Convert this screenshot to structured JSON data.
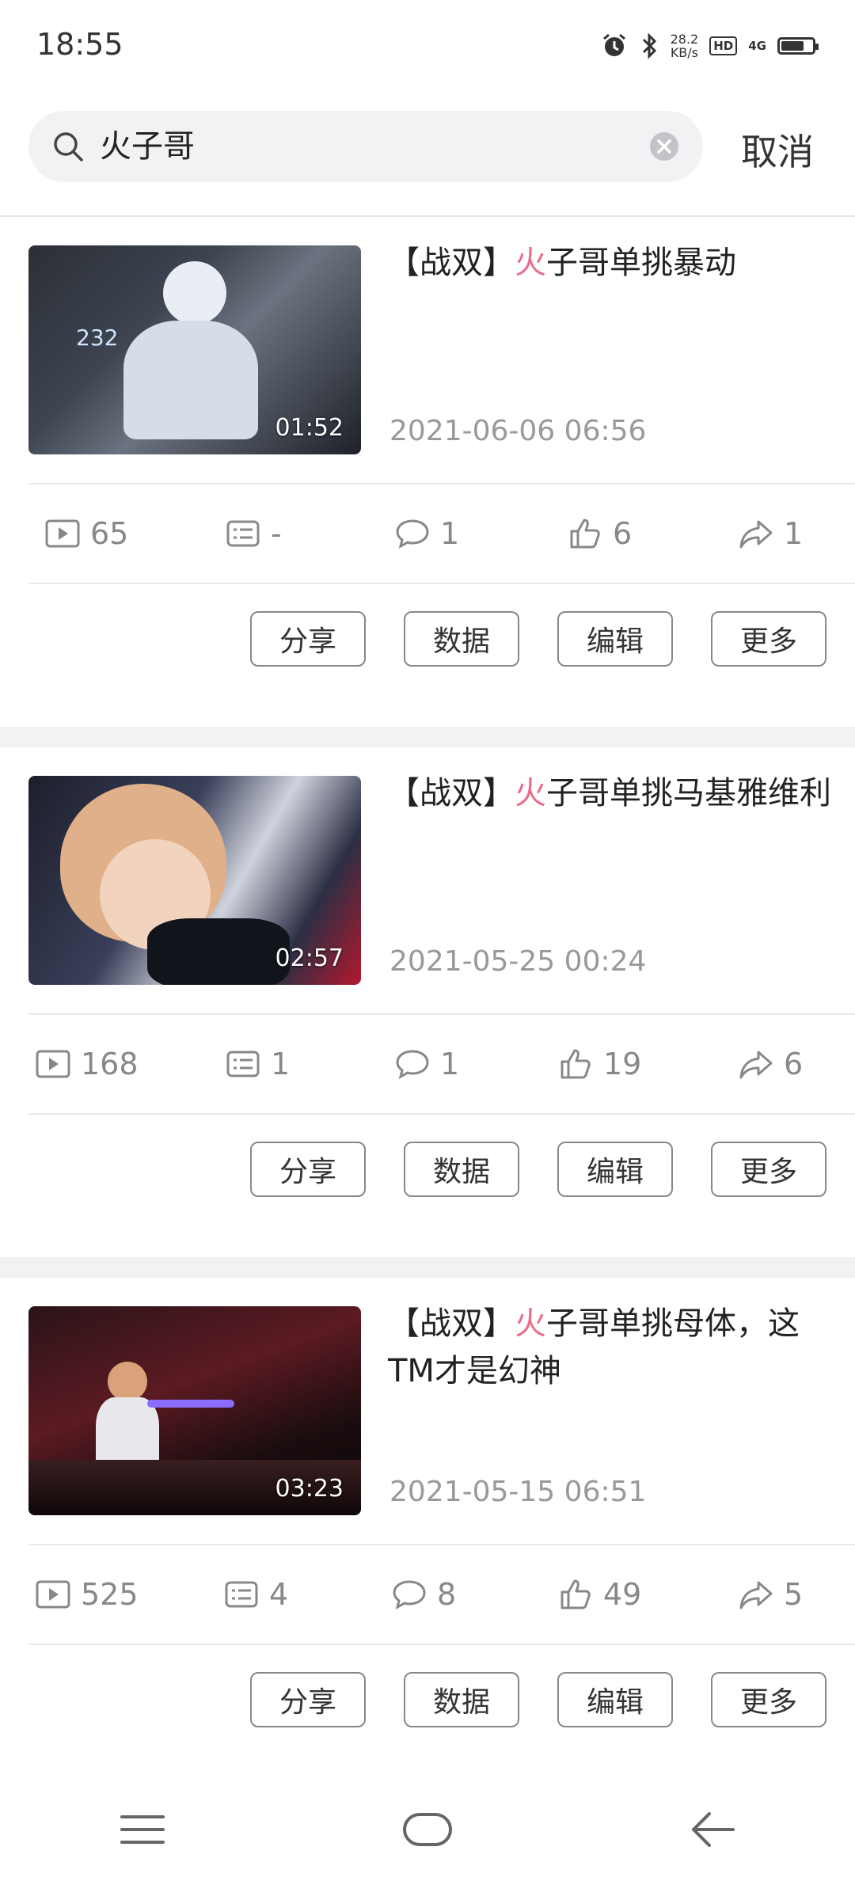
{
  "status_bar": {
    "time": "18:55",
    "net_speed": "28.2",
    "net_unit": "KB/s",
    "hd": "HD",
    "signal": "4G"
  },
  "search": {
    "query": "火子哥",
    "cancel_label": "取消"
  },
  "videos": [
    {
      "title_prefix": "【战双】",
      "title_highlight": "火",
      "title_rest": "子哥单挑暴动",
      "duration": "01:52",
      "date": "2021-06-06 06:56",
      "plays": "65",
      "danmaku": "-",
      "comments": "1",
      "likes": "6",
      "shares": "1"
    },
    {
      "title_prefix": "【战双】",
      "title_highlight": "火",
      "title_rest": "子哥单挑马基雅维利",
      "duration": "02:57",
      "date": "2021-05-25 00:24",
      "plays": "168",
      "danmaku": "1",
      "comments": "1",
      "likes": "19",
      "shares": "6"
    },
    {
      "title_prefix": "【战双】",
      "title_highlight": "火",
      "title_rest": "子哥单挑母体，这TM才是幻神",
      "duration": "03:23",
      "date": "2021-05-15 06:51",
      "plays": "525",
      "danmaku": "4",
      "comments": "8",
      "likes": "49",
      "shares": "5"
    }
  ],
  "actions": {
    "share": "分享",
    "data": "数据",
    "edit": "编辑",
    "more": "更多"
  },
  "colors": {
    "highlight": "#ea6e8c",
    "muted": "#888888"
  }
}
